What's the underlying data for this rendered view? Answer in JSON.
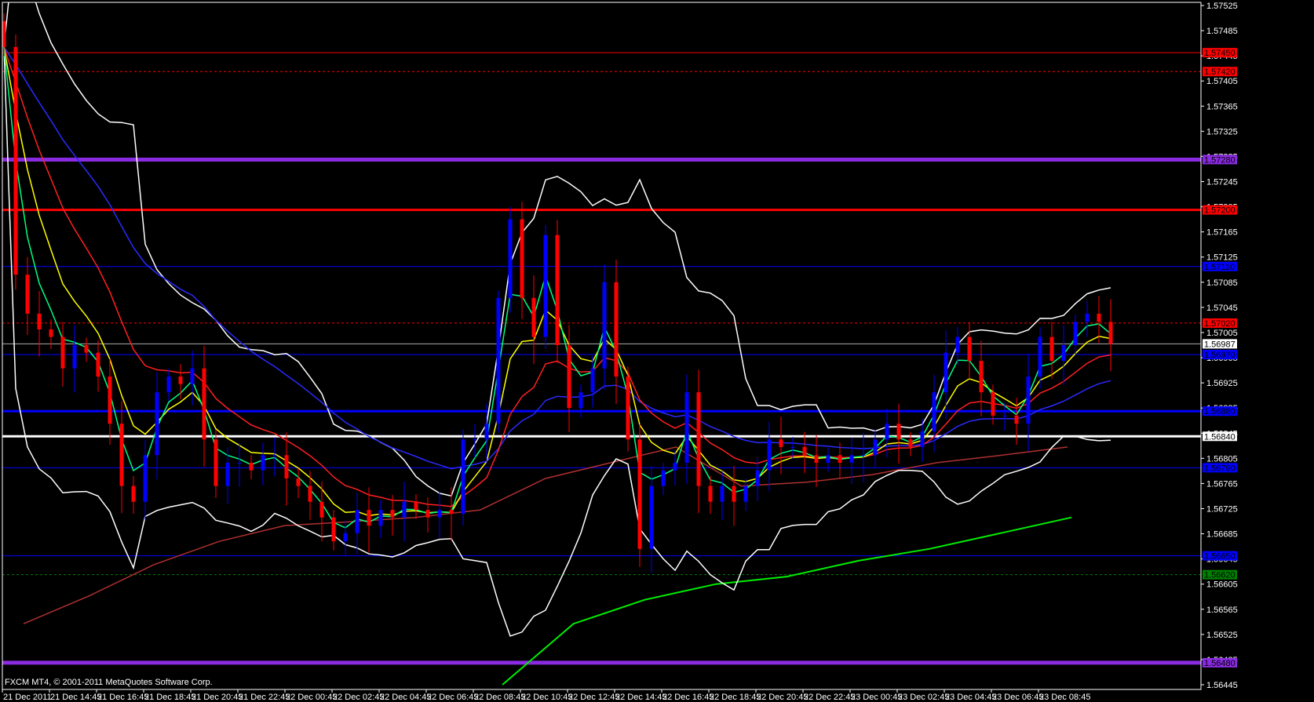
{
  "window": {
    "copyright": "FXCM MT4, © 2001-2011 MetaQuotes Software Corp."
  },
  "colors": {
    "background": "#000000",
    "bull": "#0000ff",
    "bear": "#ff0000",
    "axis": "#ffffff",
    "ema_fast": "#00ff80",
    "ema_mid": "#ffff00",
    "ema_slow": "#ff2020",
    "ema_long": "#2a2aff",
    "bands": "#ffffff",
    "ma_brown": "#b03030",
    "ma_green": "#00ee00"
  },
  "chart_data": {
    "type": "candlestick",
    "symbol_timeframe": "M15",
    "ylim": [
      1.56445,
      1.57525
    ],
    "y_ticks": [
      "1.57525",
      "1.57485",
      "1.57445",
      "1.57405",
      "1.57365",
      "1.57325",
      "1.57285",
      "1.57245",
      "1.57205",
      "1.57165",
      "1.57125",
      "1.57085",
      "1.57045",
      "1.57005",
      "1.56965",
      "1.56925",
      "1.56885",
      "1.56845",
      "1.56805",
      "1.56765",
      "1.56725",
      "1.56685",
      "1.56645",
      "1.56605",
      "1.56565",
      "1.56525",
      "1.56485",
      "1.56445"
    ],
    "x_labels": [
      "21 Dec 2011",
      "21 Dec 14:45",
      "21 Dec 16:45",
      "21 Dec 18:45",
      "21 Dec 20:45",
      "21 Dec 22:45",
      "22 Dec 00:45",
      "22 Dec 02:45",
      "22 Dec 04:45",
      "22 Dec 06:45",
      "22 Dec 08:45",
      "22 Dec 10:45",
      "22 Dec 12:45",
      "22 Dec 14:45",
      "22 Dec 16:45",
      "22 Dec 18:45",
      "22 Dec 20:45",
      "22 Dec 22:45",
      "23 Dec 00:45",
      "23 Dec 02:45",
      "23 Dec 04:45",
      "23 Dec 06:45",
      "23 Dec 08:45"
    ],
    "levels": [
      {
        "price": 1.5745,
        "label": "1.57450",
        "color": "#ff0000",
        "style": "solid",
        "weight": 1
      },
      {
        "price": 1.5742,
        "label": "1.57420",
        "color": "#ff0000",
        "style": "dashed",
        "weight": 1
      },
      {
        "price": 1.5728,
        "label": "1.57280",
        "color": "#8a2be2",
        "style": "solid",
        "weight": 5
      },
      {
        "price": 1.572,
        "label": "1.57200",
        "color": "#ff0000",
        "style": "solid",
        "weight": 3
      },
      {
        "price": 1.5711,
        "label": "1.57110",
        "color": "#0000ff",
        "style": "solid",
        "weight": 1
      },
      {
        "price": 1.5702,
        "label": "1.57020",
        "color": "#ff0000",
        "style": "dashed",
        "weight": 1
      },
      {
        "price": 1.56987,
        "label": "1.56987",
        "color": "#aaaaaa",
        "style": "solid",
        "weight": 1,
        "tag_bg": "#ffffff",
        "tag_fg": "#000000"
      },
      {
        "price": 1.5697,
        "label": "1.56970",
        "color": "#0000ff",
        "style": "solid",
        "weight": 1
      },
      {
        "price": 1.5688,
        "label": "1.56880",
        "color": "#0000ff",
        "style": "solid",
        "weight": 3
      },
      {
        "price": 1.5684,
        "label": "1.56840",
        "color": "#ffffff",
        "style": "solid",
        "weight": 3,
        "tag_fg": "#000000"
      },
      {
        "price": 1.5679,
        "label": "1.56790",
        "color": "#0000ff",
        "style": "solid",
        "weight": 1
      },
      {
        "price": 1.5665,
        "label": "1.56650",
        "color": "#0000ff",
        "style": "solid",
        "weight": 1
      },
      {
        "price": 1.5662,
        "label": "1.56620",
        "color": "#008000",
        "style": "dashed",
        "weight": 1
      },
      {
        "price": 1.5648,
        "label": "1.56480",
        "color": "#8a2be2",
        "style": "solid",
        "weight": 5
      }
    ],
    "closes": [
      1.57459,
      1.57097,
      1.57035,
      1.5701,
      1.56998,
      1.56948,
      1.56985,
      1.56973,
      1.56935,
      1.5686,
      1.56761,
      1.56736,
      1.5681,
      1.5691,
      1.56935,
      1.56923,
      1.56948,
      1.56835,
      1.56761,
      1.56798,
      1.56798,
      1.56786,
      1.5681,
      1.5681,
      1.56773,
      1.56761,
      1.56736,
      1.56711,
      1.56673,
      1.56686,
      1.56723,
      1.56698,
      1.56723,
      1.56711,
      1.56736,
      1.56723,
      1.56711,
      1.56723,
      1.56717,
      1.56835,
      1.56835,
      1.5686,
      1.5706,
      1.57185,
      1.5706,
      1.56998,
      1.5716,
      1.56985,
      1.56885,
      1.5691,
      1.56948,
      1.57085,
      1.56935,
      1.56835,
      1.56661,
      1.56761,
      1.56786,
      1.56798,
      1.5691,
      1.56761,
      1.56736,
      1.56761,
      1.56736,
      1.56761,
      1.56786,
      1.56835,
      1.56823,
      1.56823,
      1.5681,
      1.56798,
      1.5681,
      1.56798,
      1.5681,
      1.5681,
      1.56835,
      1.5686,
      1.56835,
      1.56823,
      1.56848,
      1.5691,
      1.56973,
      1.56998,
      1.5696,
      1.5691,
      1.56873,
      1.56873,
      1.5686,
      1.56935,
      1.56998,
      1.5696,
      1.56985,
      1.57022,
      1.57035,
      1.57022,
      1.56987
    ],
    "ma_brown": [
      1.56542,
      1.56586,
      1.56636,
      1.56673,
      1.56698,
      1.56704,
      1.56711,
      1.56723,
      1.56773,
      1.56798,
      1.56823,
      1.56761,
      1.56767,
      1.56779,
      1.56798,
      1.5681,
      1.56823
    ],
    "ma_green": [
      1.56445,
      1.56542,
      1.5658,
      1.56605,
      1.56617,
      1.56642,
      1.56661,
      1.56686,
      1.56711
    ]
  }
}
